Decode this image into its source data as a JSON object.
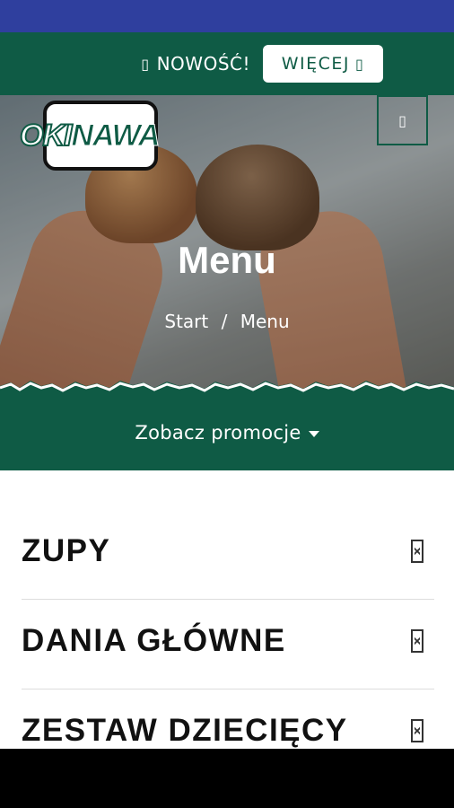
{
  "promo_bar": {
    "icon": "gift-icon",
    "text": "NOWOŚĆ!",
    "button_label": "WIĘCEJ",
    "button_icon": "arrow-right-icon"
  },
  "header": {
    "logo_text_1": "OKI",
    "logo_text_2": "NAWA",
    "menu_icon": "hamburger-icon"
  },
  "hero": {
    "title": "Menu",
    "breadcrumb": [
      "Start",
      "/",
      "Menu"
    ]
  },
  "promotions": {
    "label": "Zobacz promocje"
  },
  "categories": [
    {
      "label": "ZUPY",
      "icon": "expand-icon"
    },
    {
      "label": "DANIA GŁÓWNE",
      "icon": "expand-icon"
    },
    {
      "label": "ZESTAW DZIECIĘCY",
      "icon": "expand-icon"
    }
  ],
  "colors": {
    "brand_green": "#0f5b45",
    "status_bar": "#2f3f9e"
  }
}
